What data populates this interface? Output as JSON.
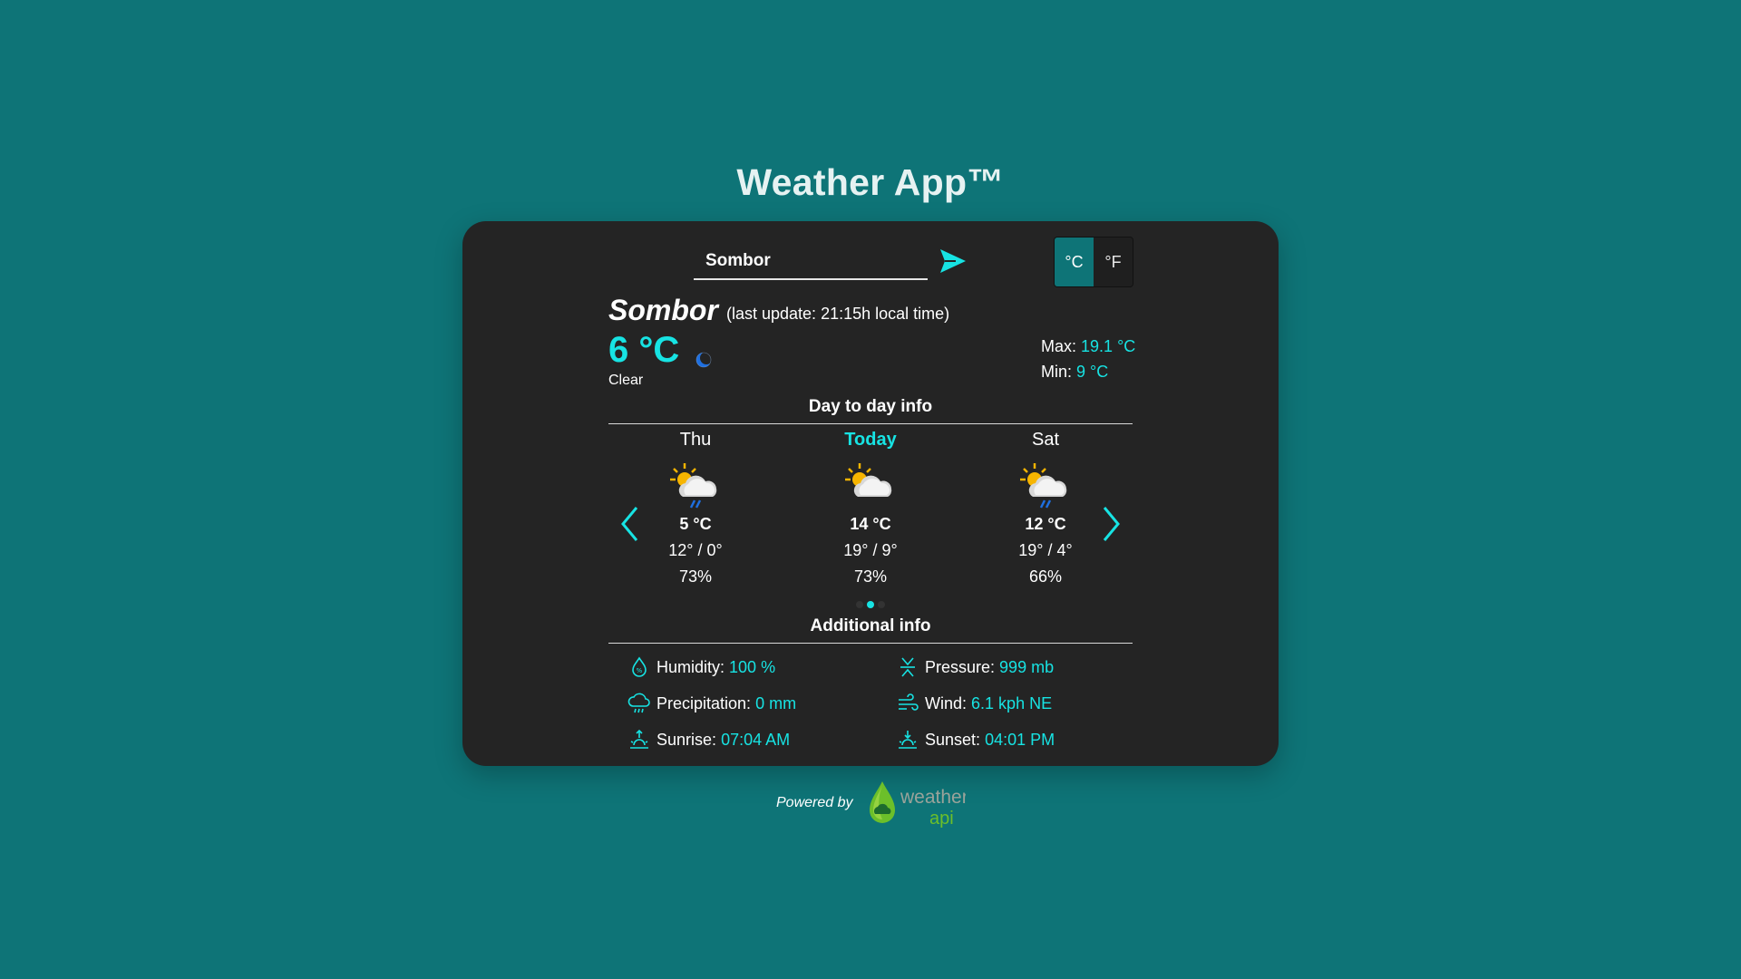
{
  "app": {
    "title": "Weather App™"
  },
  "search": {
    "value": "Sombor",
    "placeholder": ""
  },
  "units": {
    "celsius": "°C",
    "fahrenheit": "°F",
    "active": "celsius"
  },
  "current": {
    "location": "Sombor",
    "last_update": "(last update: 21:15h local time)",
    "temp": "6 °C",
    "condition": "Clear",
    "icon": "moon-icon",
    "max_label": "Max:",
    "max_value": "19.1 °C",
    "min_label": "Min:",
    "min_value": "9 °C"
  },
  "forecast": {
    "title": "Day to day info",
    "days": [
      {
        "name": "Thu",
        "icon": "partly-cloudy-rain-icon",
        "temp": "5 °C",
        "range": "12° / 0°",
        "humidity": "73%"
      },
      {
        "name": "Today",
        "icon": "partly-cloudy-icon",
        "temp": "14 °C",
        "range": "19° / 9°",
        "humidity": "73%"
      },
      {
        "name": "Sat",
        "icon": "partly-cloudy-rain-icon",
        "temp": "12 °C",
        "range": "19° / 4°",
        "humidity": "66%"
      }
    ],
    "active_page": 2,
    "page_count": 3
  },
  "additional": {
    "title": "Additional info",
    "humidity_label": "Humidity:",
    "humidity_value": "100 %",
    "pressure_label": "Pressure:",
    "pressure_value": "999 mb",
    "precip_label": "Precipitation:",
    "precip_value": "0 mm",
    "wind_label": "Wind:",
    "wind_value": "6.1 kph NE",
    "sunrise_label": "Sunrise:",
    "sunrise_value": "07:04 AM",
    "sunset_label": "Sunset:",
    "sunset_value": "04:01 PM"
  },
  "footer": {
    "powered_by": "Powered by",
    "brand_top": "weather",
    "brand_bottom": "api"
  },
  "colors": {
    "background": "#0e7477",
    "card": "#242424",
    "accent": "#17e3e3"
  }
}
